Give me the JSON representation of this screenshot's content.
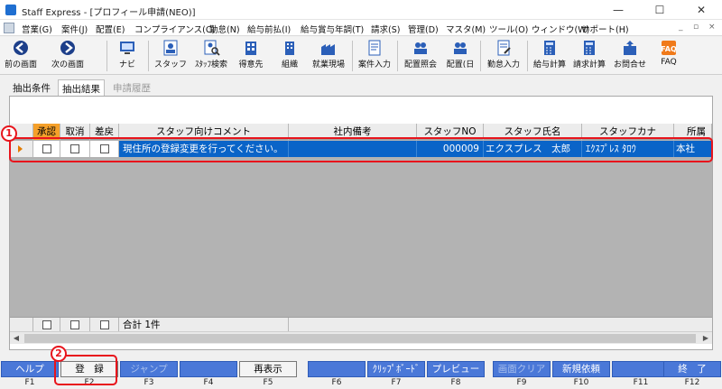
{
  "window": {
    "title": "Staff Express - [プロフィール申請(NEO)]",
    "min": "—",
    "max": "☐",
    "close": "✕"
  },
  "menu": {
    "items": [
      "営業(G)",
      "案件(J)",
      "配置(E)",
      "コンプライアンス(C)",
      "勤怠(N)",
      "給与前払(I)",
      "給与賞与年調(T)",
      "請求(S)",
      "管理(D)",
      "マスタ(M)",
      "ツール(O)",
      "ウィンドウ(W)",
      "サポート(H)"
    ],
    "mdi_min": "_",
    "mdi_restore": "▫",
    "mdi_close": "×"
  },
  "toolbar": {
    "back": "前の画面",
    "next": "次の画面",
    "nav": "ナビ",
    "staff": "スタッフ",
    "staff_search": "ｽﾀｯﾌ検索",
    "client": "得意先",
    "org": "組織",
    "site": "就業現場",
    "case_input": "案件入力",
    "placement_ref": "配置照会",
    "placement_day": "配置(日",
    "attendance_input": "勤怠入力",
    "pay_calc": "給与計算",
    "bill_calc": "請求計算",
    "inquiry": "お問合せ",
    "faq": "FAQ"
  },
  "tabs": {
    "conditions": "抽出条件",
    "results": "抽出結果",
    "history": "申請履歴"
  },
  "grid": {
    "headers": {
      "approve": "承認",
      "cancel": "取消",
      "return": "差戻",
      "comment": "スタッフ向けコメント",
      "memo": "社内備考",
      "staff_no": "スタッフNO",
      "name": "スタッフ氏名",
      "kana": "スタッフカナ",
      "office": "所属"
    },
    "rows": [
      {
        "comment": "現住所の登録変更を行ってください。",
        "memo": "",
        "staff_no": "000009",
        "name": "エクスプレス　太郎",
        "kana": "ｴｸｽﾌﾟﾚｽ ﾀﾛｳ",
        "office": "本社"
      }
    ],
    "total": "合計 1件"
  },
  "fkeys": [
    {
      "label": "ヘルプ",
      "key": "F1"
    },
    {
      "label": "登　録",
      "key": "F2"
    },
    {
      "label": "ジャンプ",
      "key": "F3"
    },
    {
      "label": "",
      "key": "F4"
    },
    {
      "label": "再表示",
      "key": "F5"
    },
    {
      "label": "",
      "key": "F6"
    },
    {
      "label": "ｸﾘｯﾌﾟﾎﾞｰﾄﾞ",
      "key": "F7"
    },
    {
      "label": "プレビュー",
      "key": "F8"
    },
    {
      "label": "画面クリア",
      "key": "F9"
    },
    {
      "label": "新規依頼",
      "key": "F10"
    },
    {
      "label": "",
      "key": "F11"
    },
    {
      "label": "終　了",
      "key": "F12"
    }
  ],
  "annotations": {
    "one": "1",
    "two": "2"
  },
  "colors": {
    "accent": "#4a78d8",
    "selected_row": "#0a64c8",
    "approve_header": "#f5a02a",
    "callout": "#e8141c"
  }
}
